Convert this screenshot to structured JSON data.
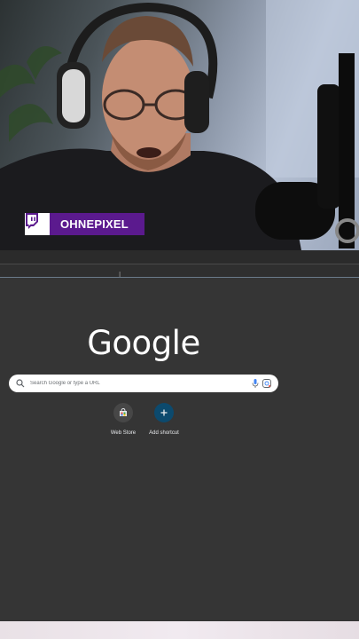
{
  "stream": {
    "channel_name": "OHNEPIXEL",
    "platform_icon": "twitch-icon",
    "badge_color": "#5b1a8e"
  },
  "divider": {
    "cursor_glyph": "I"
  },
  "new_tab": {
    "logo_text": "Google",
    "search": {
      "placeholder": "Search Google or type a URL",
      "search_icon": "search-icon",
      "mic_icon": "mic-icon",
      "lens_icon": "lens-icon"
    },
    "shortcuts": [
      {
        "label": "Web Store",
        "icon": "web-store-icon"
      },
      {
        "label": "Add shortcut",
        "icon": "plus-icon"
      }
    ]
  },
  "colors": {
    "ntp_background": "#353535",
    "search_background": "#ffffff",
    "add_shortcut_tile": "#0c4a6e"
  }
}
